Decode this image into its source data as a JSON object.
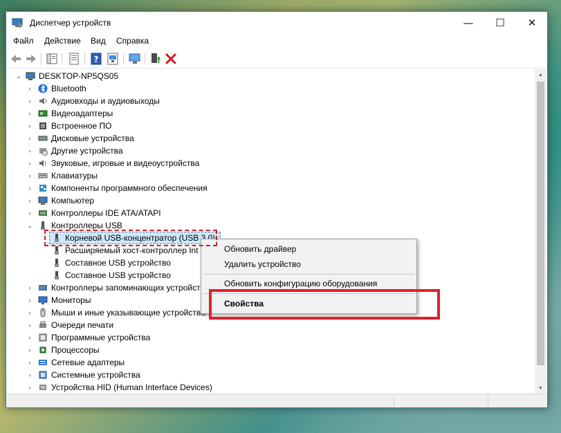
{
  "window": {
    "title": "Диспетчер устройств",
    "minimize_glyph": "—",
    "maximize_glyph": "☐",
    "close_glyph": "✕"
  },
  "menu": [
    "Файл",
    "Действие",
    "Вид",
    "Справка"
  ],
  "toolbar": [
    "back-icon",
    "forward-icon",
    "show-hide-tree-icon",
    "properties-icon",
    "help-icon",
    "show-devices-icon",
    "update-driver-icon",
    "uninstall-device-icon"
  ],
  "tree": {
    "root": "DESKTOP-NP5QS05",
    "categories": [
      {
        "label": "Bluetooth",
        "icon": "bluetooth-icon",
        "expanded": false
      },
      {
        "label": "Аудиовходы и аудиовыходы",
        "icon": "speaker-icon",
        "expanded": false
      },
      {
        "label": "Видеоадаптеры",
        "icon": "display-adapter-icon",
        "expanded": false
      },
      {
        "label": "Встроенное ПО",
        "icon": "firmware-icon",
        "expanded": false
      },
      {
        "label": "Дисковые устройства",
        "icon": "disk-drive-icon",
        "expanded": false
      },
      {
        "label": "Другие устройства",
        "icon": "unknown-device-icon",
        "expanded": false
      },
      {
        "label": "Звуковые, игровые и видеоустройства",
        "icon": "sound-icon",
        "expanded": false
      },
      {
        "label": "Клавиатуры",
        "icon": "keyboard-icon",
        "expanded": false
      },
      {
        "label": "Компоненты программного обеспечения",
        "icon": "software-component-icon",
        "expanded": false
      },
      {
        "label": "Компьютер",
        "icon": "computer-icon",
        "expanded": false
      },
      {
        "label": "Контроллеры IDE ATA/ATAPI",
        "icon": "ide-controller-icon",
        "expanded": false
      },
      {
        "label": "Контроллеры USB",
        "icon": "usb-icon",
        "expanded": true,
        "children": [
          "Корневой USB-концентратор (USB 3.0)",
          "Расширяемый хост-контроллер Int",
          "Составное USB устройство",
          "Составное USB устройство"
        ]
      },
      {
        "label": "Контроллеры запоминающих устройств",
        "icon": "storage-controller-icon",
        "expanded": false
      },
      {
        "label": "Мониторы",
        "icon": "monitor-icon",
        "expanded": false
      },
      {
        "label": "Мыши и иные указывающие устройства",
        "icon": "mouse-icon",
        "expanded": false
      },
      {
        "label": "Очереди печати",
        "icon": "print-queue-icon",
        "expanded": false
      },
      {
        "label": "Программные устройства",
        "icon": "software-device-icon",
        "expanded": false
      },
      {
        "label": "Процессоры",
        "icon": "processor-icon",
        "expanded": false
      },
      {
        "label": "Сетевые адаптеры",
        "icon": "network-adapter-icon",
        "expanded": false
      },
      {
        "label": "Системные устройства",
        "icon": "system-device-icon",
        "expanded": false
      },
      {
        "label": "Устройства HID (Human Interface Devices)",
        "icon": "hid-icon",
        "expanded": false
      }
    ]
  },
  "context_menu": {
    "update_driver": "Обновить драйвер",
    "uninstall_device": "Удалить устройство",
    "scan_hardware": "Обновить конфигурацию оборудования",
    "properties": "Свойства"
  },
  "colors": {
    "selection": "#cce8ff",
    "highlight_red": "#e0202a",
    "title_border": "#2d7fb8"
  }
}
